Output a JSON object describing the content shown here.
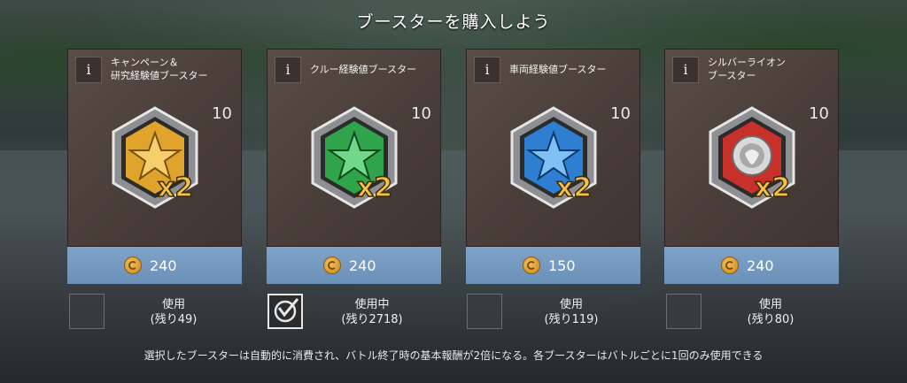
{
  "title": "ブースターを購入しよう",
  "cards": [
    {
      "name_line1": "キャンペーン＆",
      "name_line2": "研究経験値ブースター",
      "info": "i",
      "count": "10",
      "multiplier": "x2",
      "price": "240",
      "use_line1": "使用",
      "use_line2": "(残り49)",
      "checked": false,
      "badge_color": "#e0a32b",
      "icon": "gold-star-badge-icon"
    },
    {
      "name_line1": "クルー経験値ブースター",
      "name_line2": "",
      "info": "i",
      "count": "10",
      "multiplier": "x2",
      "price": "240",
      "use_line1": "使用中",
      "use_line2": "(残り2718)",
      "checked": true,
      "badge_color": "#2fa44a",
      "icon": "green-star-badge-icon"
    },
    {
      "name_line1": "車両経験値ブースター",
      "name_line2": "",
      "info": "i",
      "count": "10",
      "multiplier": "x2",
      "price": "150",
      "use_line1": "使用",
      "use_line2": "(残り119)",
      "checked": false,
      "badge_color": "#2e7fd1",
      "icon": "blue-star-badge-icon"
    },
    {
      "name_line1": "シルバーライオン",
      "name_line2": "ブースター",
      "info": "i",
      "count": "10",
      "multiplier": "x2",
      "price": "240",
      "use_line1": "使用",
      "use_line2": "(残り80)",
      "checked": false,
      "badge_color": "#c8302a",
      "icon": "silver-lion-badge-icon"
    }
  ],
  "footer": "選択したブースターは自動的に消費され、バトル終了時の基本報酬が2倍になる。各ブースターはバトルごとに1回のみ使用できる"
}
